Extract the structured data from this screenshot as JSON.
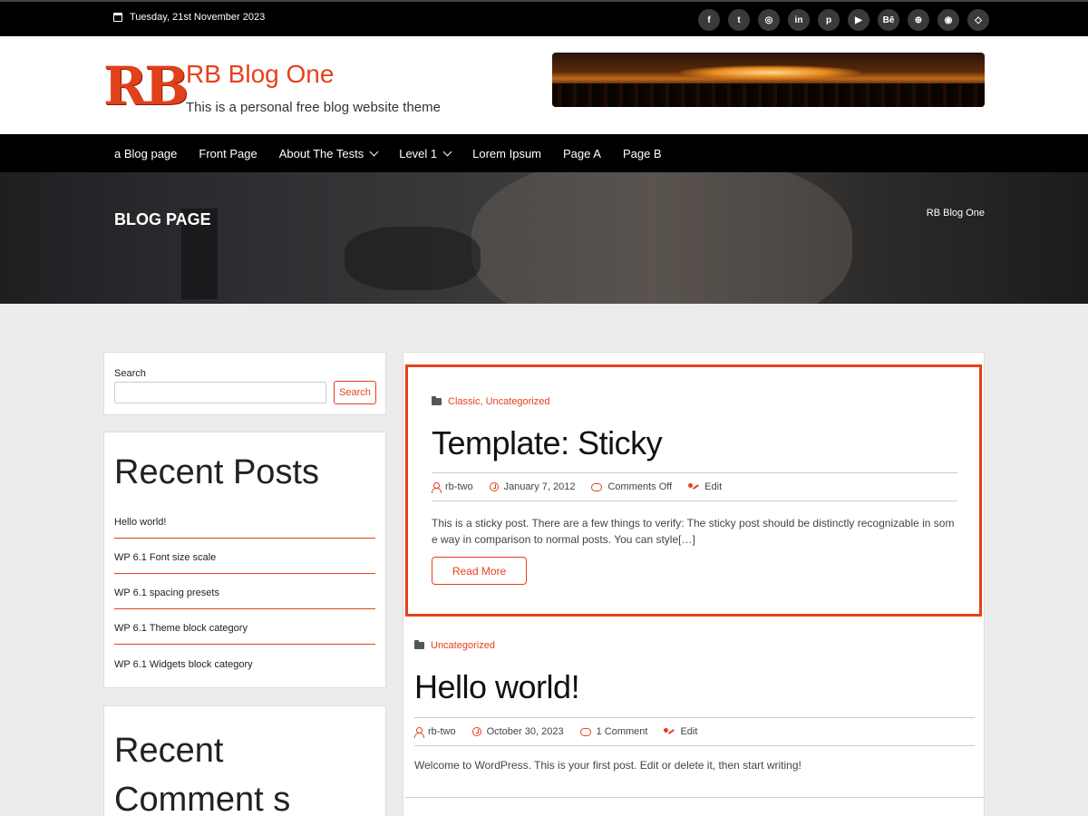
{
  "topbar": {
    "date": "Tuesday, 21st November 2023",
    "socials": [
      {
        "icon": "facebook-icon",
        "glyph": "f"
      },
      {
        "icon": "twitter-icon",
        "glyph": "t"
      },
      {
        "icon": "instagram-icon",
        "glyph": "◎"
      },
      {
        "icon": "linkedin-icon",
        "glyph": "in"
      },
      {
        "icon": "pinterest-icon",
        "glyph": "p"
      },
      {
        "icon": "youtube-icon",
        "glyph": "▶"
      },
      {
        "icon": "behance-icon",
        "glyph": "Bē"
      },
      {
        "icon": "dribbble-icon",
        "glyph": "⊕"
      },
      {
        "icon": "github-icon",
        "glyph": "◉"
      },
      {
        "icon": "codepen-icon",
        "glyph": "◇"
      }
    ]
  },
  "header": {
    "logo_text": "RB",
    "site_title": "RB Blog One",
    "site_description": "This is a personal free blog website theme"
  },
  "nav": {
    "items": [
      {
        "label": "a Blog page",
        "has_submenu": false
      },
      {
        "label": "Front Page",
        "has_submenu": false
      },
      {
        "label": "About The Tests",
        "has_submenu": true
      },
      {
        "label": "Level 1",
        "has_submenu": true
      },
      {
        "label": "Lorem Ipsum",
        "has_submenu": false
      },
      {
        "label": "Page A",
        "has_submenu": false
      },
      {
        "label": "Page B",
        "has_submenu": false
      }
    ]
  },
  "hero": {
    "title": "BLOG PAGE",
    "breadcrumb": "RB Blog One"
  },
  "sidebar": {
    "search": {
      "label": "Search",
      "value": "",
      "placeholder": "",
      "button_label": "Search"
    },
    "recent_posts": {
      "title": "Recent Posts",
      "items": [
        "Hello world!",
        "WP 6.1 Font size scale",
        "WP 6.1 spacing presets",
        "WP 6.1 Theme block category",
        "WP 6.1 Widgets block category"
      ]
    },
    "recent_comments": {
      "title": "Recent Comment s"
    }
  },
  "posts": [
    {
      "categories": [
        "Classic",
        "Uncategorized"
      ],
      "title": "Template: Sticky",
      "author": "rb-two",
      "date": "January 7, 2012",
      "comments": "Comments Off",
      "edit_label": "Edit",
      "excerpt": "This is a sticky post. There are a few things to verify: The sticky post should be distinctly recognizable in some way in comparison to normal posts. You can style[…]",
      "read_more": "Read More"
    },
    {
      "categories": [
        "Uncategorized"
      ],
      "title": "Hello world!",
      "author": "rb-two",
      "date": "October 30, 2023",
      "comments": "1 Comment",
      "edit_label": "Edit",
      "excerpt": "Welcome to WordPress. This is your first post. Edit or delete it, then start writing!"
    }
  ],
  "colors": {
    "accent": "#e8401c",
    "topbar_bg": "#000000",
    "nav_bg": "#000000",
    "page_bg": "#ececec"
  }
}
